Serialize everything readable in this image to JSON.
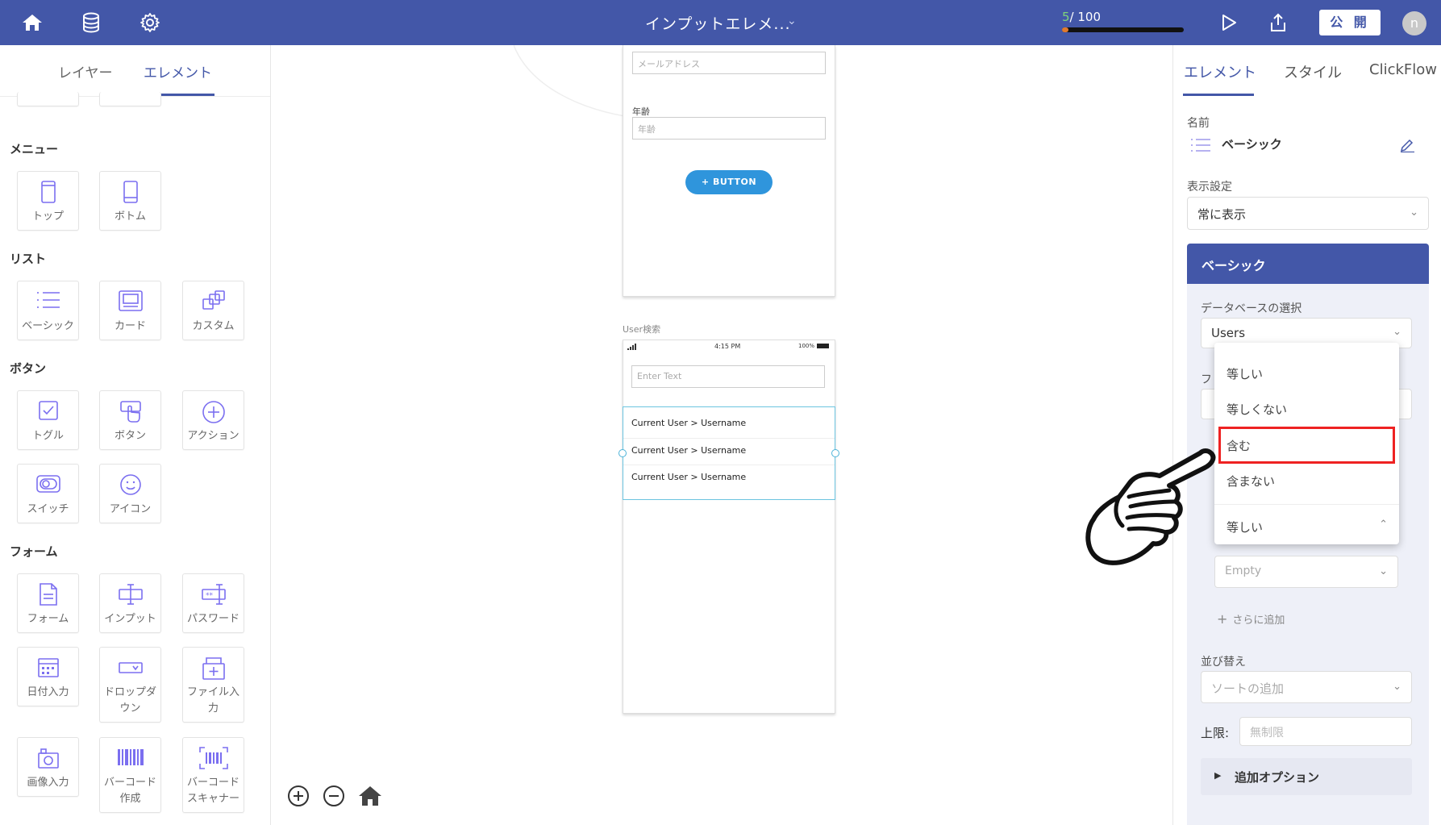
{
  "topbar": {
    "title": "インプットエレメ...",
    "progress_current": "5",
    "progress_total": "/ 100",
    "progress_fraction": 0.05,
    "publish_label": "公 開",
    "avatar_initial": "n"
  },
  "left_panel": {
    "tabs": [
      "レイヤー",
      "エレメント"
    ],
    "active_tab": "エレメント",
    "sections": {
      "menu": "メニュー",
      "list": "リスト",
      "button": "ボタン",
      "form": "フォーム"
    },
    "tiles": {
      "top": "トップ",
      "bottom": "ボトム",
      "basic": "ベーシック",
      "card": "カード",
      "custom": "カスタム",
      "toggle": "トグル",
      "button": "ボタン",
      "action": "アクション",
      "switch": "スイッチ",
      "icon": "アイコン",
      "form": "フォーム",
      "input": "インプット",
      "password": "パスワード",
      "date_input": "日付入力",
      "dropdown_1": "ドロップダ",
      "dropdown_2": "ウン",
      "file_input_1": "ファイル入",
      "file_input_2": "力",
      "image_input": "画像入力",
      "barcode_create_1": "バーコード",
      "barcode_create_2": "作成",
      "barcode_scanner_1": "バーコード",
      "barcode_scanner_2": "スキャナー"
    }
  },
  "canvas": {
    "screen1": {
      "email_placeholder": "メールアドレス",
      "age_label": "年齢",
      "age_placeholder": "年齢",
      "button_label": "+ BUTTON"
    },
    "screen2": {
      "name": "User検索",
      "status_time": "4:15 PM",
      "status_battery": "100%",
      "search_placeholder": "Enter Text",
      "rows": [
        "Current User > Username",
        "Current User > Username",
        "Current User > Username"
      ]
    }
  },
  "right_panel": {
    "tabs": [
      "エレメント",
      "スタイル",
      "ClickFlow"
    ],
    "active_tab": "エレメント",
    "name_label": "名前",
    "name_value": "ベーシック",
    "visibility_label": "表示設定",
    "visibility_value": "常に表示",
    "panel_title": "ベーシック",
    "db_label": "データベースの選択",
    "db_value": "Users",
    "empty_value": "Empty",
    "add_more": "さらに追加",
    "sort_label": "並び替え",
    "sort_placeholder": "ソートの追加",
    "limit_label": "上限:",
    "limit_placeholder": "無制限",
    "extra_options": "追加オプション",
    "partial_label": "フ"
  },
  "dropdown": {
    "options": [
      "等しい",
      "等しくない",
      "含む",
      "含まない"
    ],
    "selected_display": "等しい",
    "highlighted": "含む"
  },
  "colors": {
    "brand": "#4357a8",
    "highlight": "#ee2222",
    "button_blue": "#2f95dc"
  }
}
